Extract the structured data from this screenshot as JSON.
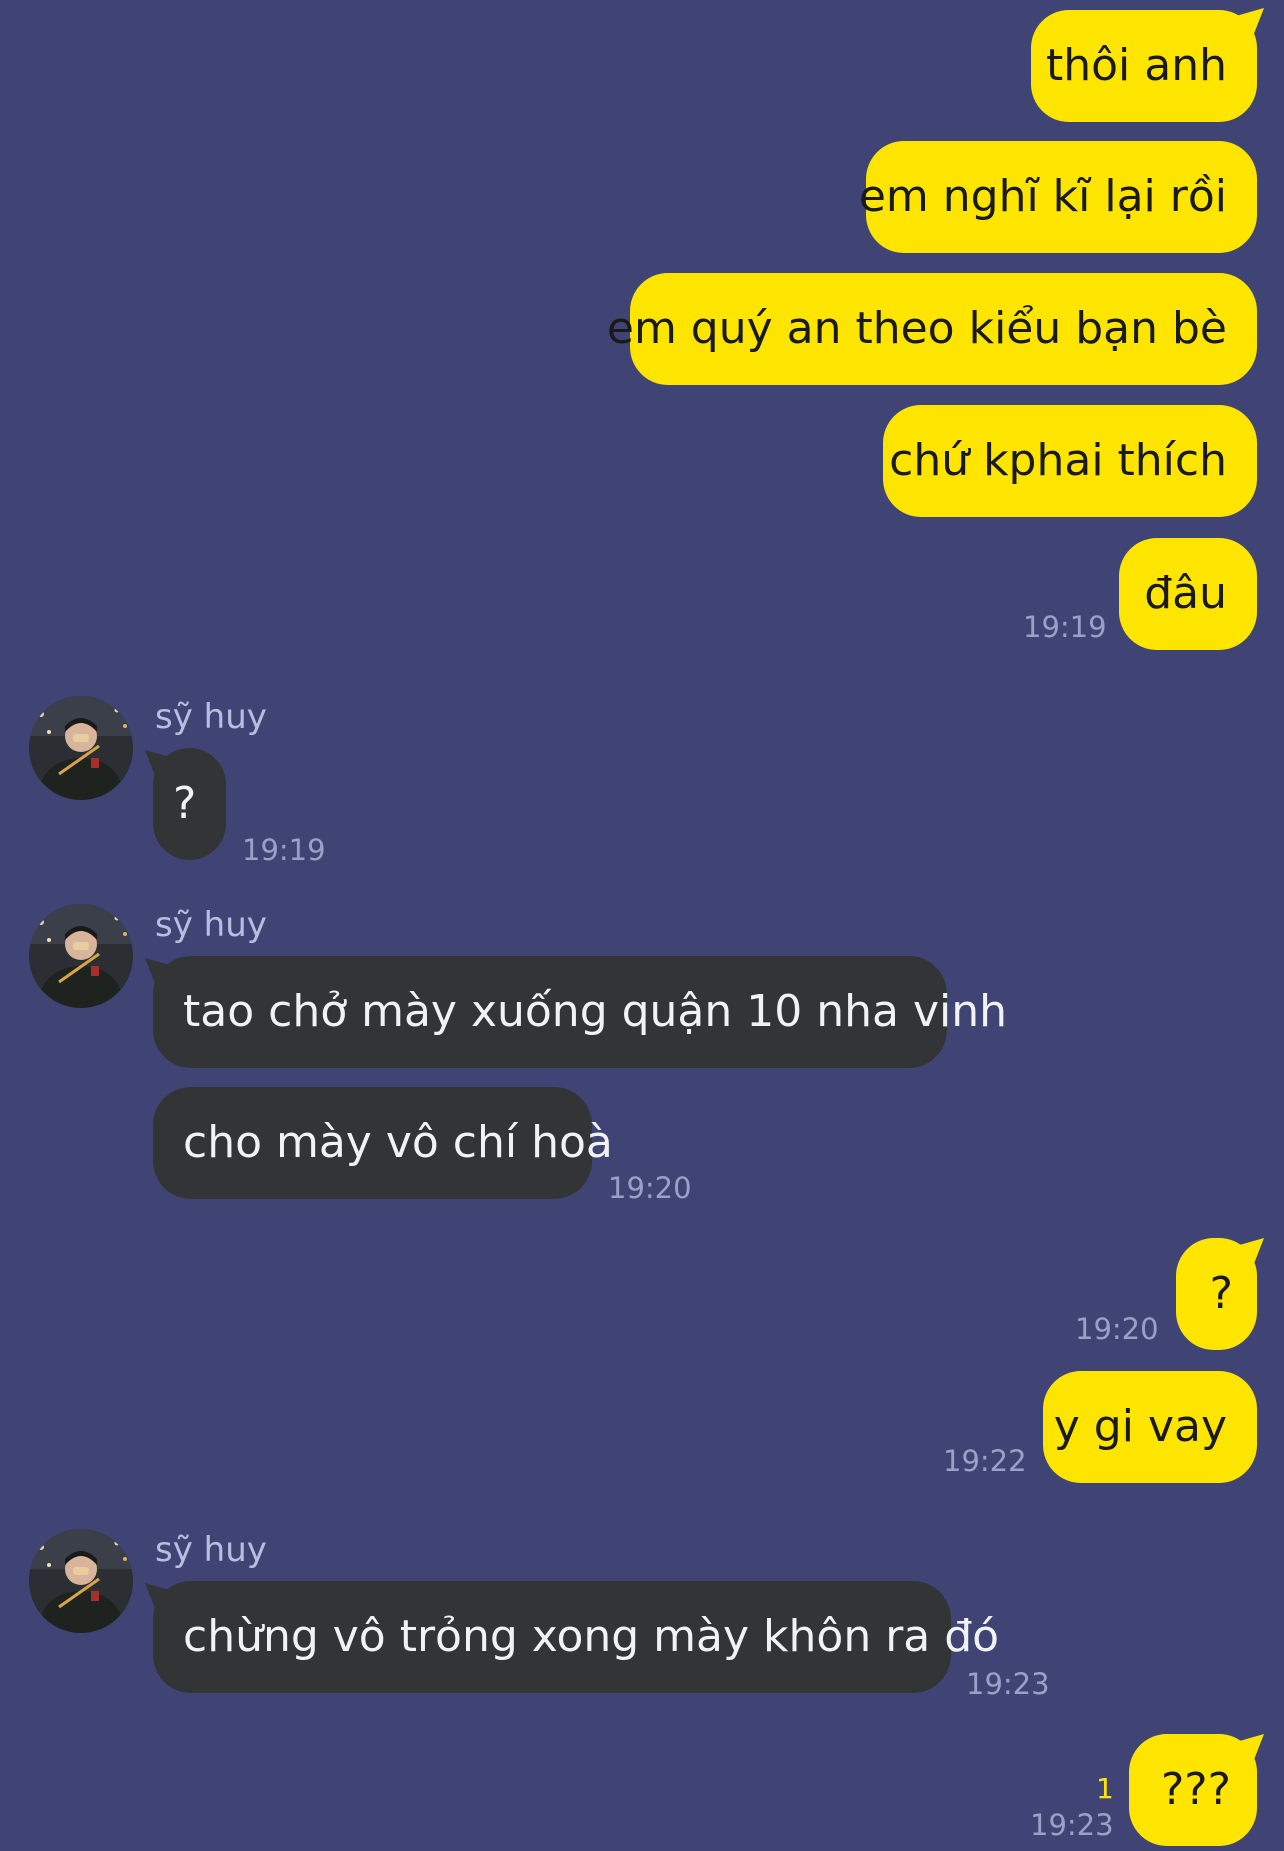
{
  "colors": {
    "background": "#3f4475",
    "outgoing_bubble": "#fee500",
    "incoming_bubble": "#333436",
    "timestamp": "#9aa0c6",
    "sender_name": "#b9bedf",
    "unread_count": "#fee500"
  },
  "messages": [
    {
      "direction": "out",
      "text": "thôi anh"
    },
    {
      "direction": "out",
      "text": "em nghĩ kĩ lại rồi"
    },
    {
      "direction": "out",
      "text": "em quý an theo kiểu bạn bè"
    },
    {
      "direction": "out",
      "text": "chứ kphai thích"
    },
    {
      "direction": "out",
      "text": "đâu",
      "time": "19:19"
    },
    {
      "direction": "in",
      "sender": "sỹ huy",
      "avatar_icon": "user-photo-avatar",
      "text": "?",
      "time": "19:19"
    },
    {
      "direction": "in",
      "sender": "sỹ huy",
      "avatar_icon": "user-photo-avatar",
      "text": "tao chở mày xuống quận 10 nha vinh"
    },
    {
      "direction": "in",
      "text": "cho mày vô chí hoà",
      "time": "19:20"
    },
    {
      "direction": "out",
      "text": "?",
      "time": "19:20"
    },
    {
      "direction": "out",
      "text": "y gi vay",
      "time": "19:22"
    },
    {
      "direction": "in",
      "sender": "sỹ huy",
      "avatar_icon": "user-photo-avatar",
      "text": "chừng vô trỏng xong mày khôn ra đó",
      "time": "19:23"
    },
    {
      "direction": "out",
      "text": "???",
      "time": "19:23",
      "unread": "1"
    }
  ]
}
